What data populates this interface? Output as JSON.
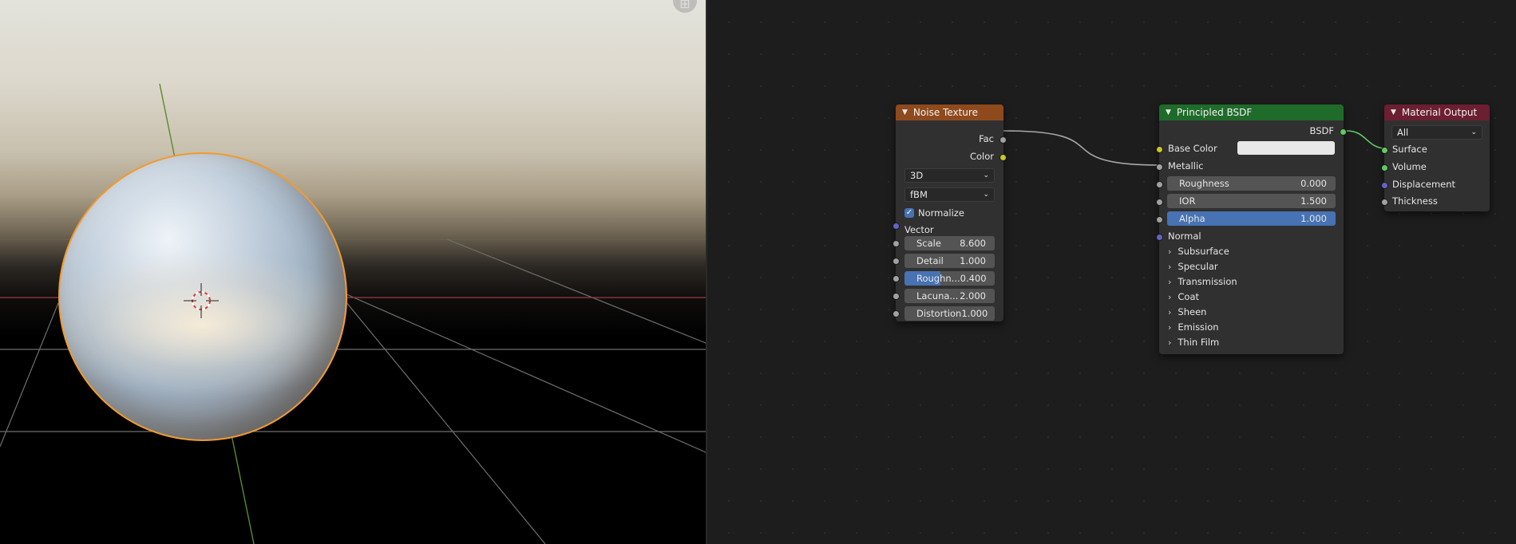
{
  "viewport": {
    "gizmo_icon": "grid-icon"
  },
  "noise_texture": {
    "title": "Noise Texture",
    "header_color": "#8e4a1d",
    "outputs": [
      "Fac",
      "Color"
    ],
    "dimension": "3D",
    "type": "fBM",
    "normalize_label": "Normalize",
    "normalize_checked": true,
    "vector_label": "Vector",
    "fields": [
      {
        "label": "Scale",
        "value": "8.600"
      },
      {
        "label": "Detail",
        "value": "1.000"
      },
      {
        "label": "Roughn...",
        "value": "0.400",
        "fill": 0.4
      },
      {
        "label": "Lacuna...",
        "value": "2.000"
      },
      {
        "label": "Distortion",
        "value": "1.000"
      }
    ]
  },
  "principled_bsdf": {
    "title": "Principled BSDF",
    "header_color": "#1f6b2a",
    "output": "BSDF",
    "base_color_label": "Base Color",
    "base_color_value": "#e8e8e8",
    "metallic_label": "Metallic",
    "fields": [
      {
        "label": "Roughness",
        "value": "0.000"
      },
      {
        "label": "IOR",
        "value": "1.500"
      },
      {
        "label": "Alpha",
        "value": "1.000",
        "fill": 1.0
      }
    ],
    "normal_label": "Normal",
    "panels": [
      "Subsurface",
      "Specular",
      "Transmission",
      "Coat",
      "Sheen",
      "Emission",
      "Thin Film"
    ]
  },
  "material_output": {
    "title": "Material Output",
    "header_color": "#6b1f30",
    "target": "All",
    "inputs": [
      "Surface",
      "Volume",
      "Displacement",
      "Thickness"
    ]
  }
}
